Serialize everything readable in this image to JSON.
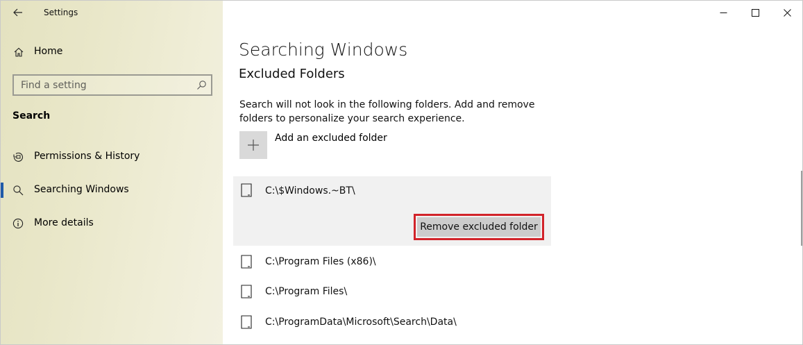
{
  "window": {
    "title": "Settings"
  },
  "sidebar": {
    "home_label": "Home",
    "search_placeholder": "Find a setting",
    "section_heading": "Search",
    "items": [
      {
        "label": "Permissions & History",
        "icon": "history-icon",
        "selected": false
      },
      {
        "label": "Searching Windows",
        "icon": "search-icon",
        "selected": true
      },
      {
        "label": "More details",
        "icon": "info-icon",
        "selected": false
      }
    ]
  },
  "main": {
    "page_title": "Searching Windows",
    "sub_title": "Excluded Folders",
    "description": "Search will not look in the following folders. Add and remove folders to personalize your search experience.",
    "add_label": "Add an excluded folder",
    "folders": [
      {
        "path": "C:\\$Windows.~BT\\",
        "selected": true
      },
      {
        "path": "C:\\Program Files (x86)\\",
        "selected": false
      },
      {
        "path": "C:\\Program Files\\",
        "selected": false
      },
      {
        "path": "C:\\ProgramData\\Microsoft\\Search\\Data\\",
        "selected": false
      }
    ],
    "remove_label": "Remove excluded folder"
  },
  "colors": {
    "accent": "#1f5aa8",
    "highlight_outline": "#d2232a",
    "selected_row_bg": "#f1f1f1",
    "button_bg": "#cccccc"
  }
}
